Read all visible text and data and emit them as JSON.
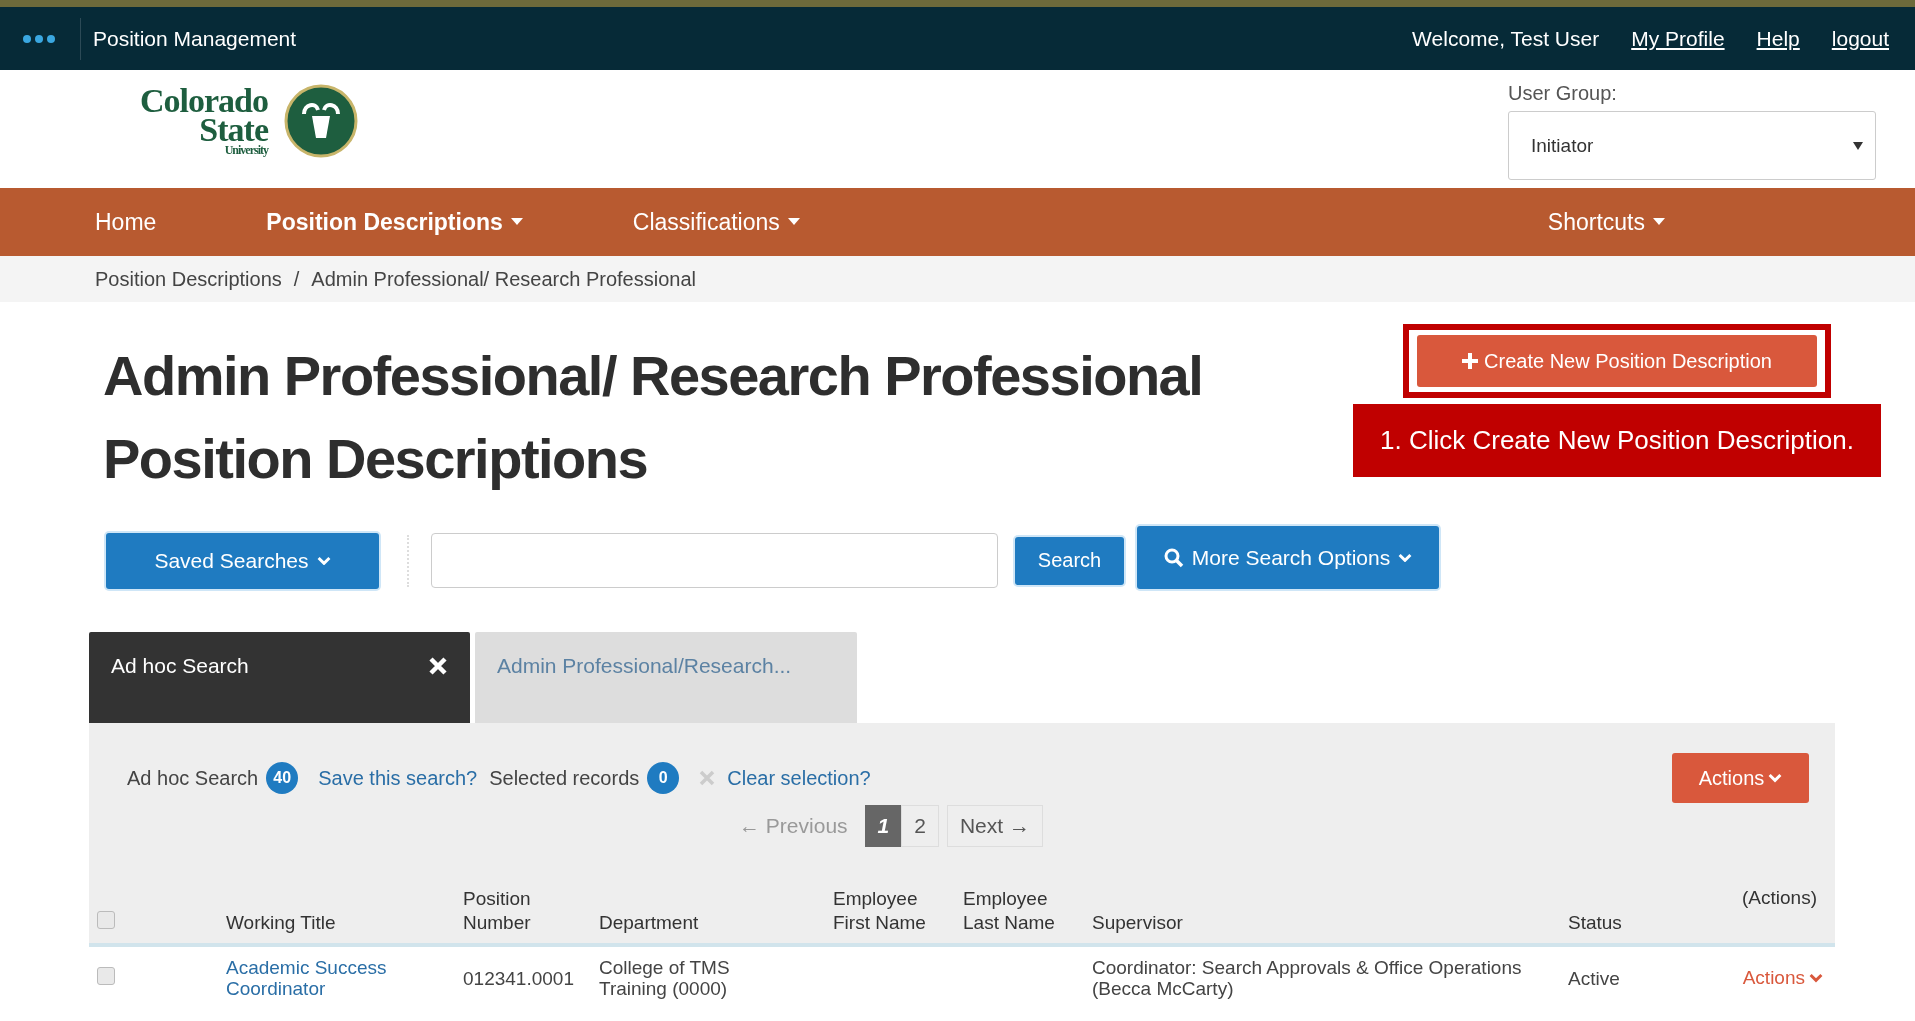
{
  "topbar": {
    "app_name": "Position Management",
    "welcome": "Welcome, Test User",
    "links": [
      "My Profile",
      "Help",
      "logout"
    ]
  },
  "logo": {
    "lines": [
      "Colorado",
      "State",
      "University"
    ]
  },
  "user_group": {
    "label": "User Group:",
    "value": "Initiator"
  },
  "nav": [
    {
      "label": "Home",
      "selected": false,
      "dropdown": false
    },
    {
      "label": "Position Descriptions",
      "selected": true,
      "dropdown": true
    },
    {
      "label": "Classifications",
      "selected": false,
      "dropdown": true
    },
    {
      "label": "Shortcuts",
      "selected": false,
      "dropdown": true
    }
  ],
  "breadcrumb": [
    "Position Descriptions",
    "Admin Professional/ Research Professional"
  ],
  "breadcrumb_separator": "/",
  "title_lines": [
    "Admin Professional/ Research Professional",
    "Position Descriptions"
  ],
  "create_button": {
    "label": "Create New Position Description",
    "highlighted": true
  },
  "callout": "1. Click Create New Position Description.",
  "search": {
    "saved_searches": "Saved Searches",
    "button": "Search",
    "more_options": "More Search Options"
  },
  "tabs": [
    {
      "label": "Ad hoc Search",
      "selected": true,
      "closable": true
    },
    {
      "label": "Admin Professional/Research...",
      "selected": false,
      "closable": false
    }
  ],
  "results": {
    "search_label": "Ad hoc Search",
    "count": "40",
    "save_link": "Save this search?",
    "selected_label": "Selected records",
    "selected_count": "0",
    "clear_link": "Clear selection?",
    "actions": "Actions"
  },
  "pagination": {
    "previous": "← Previous",
    "pages": [
      {
        "label": "1",
        "selected": true
      },
      {
        "label": "2",
        "selected": false
      }
    ],
    "next": "Next →"
  },
  "table": {
    "select_all_checked": false,
    "actions_heading": "(Actions)",
    "columns": [
      "Working Title",
      "Position Number",
      "Department",
      "Employee First Name",
      "Employee Last Name",
      "Supervisor",
      "Status"
    ],
    "rows": [
      {
        "checked": false,
        "cells": [
          "Academic Success Coordinator",
          "012341.0001",
          "College of TMS Training (0000)",
          null,
          null,
          "Coordinator: Search Approvals & Office Operations (Becca McCarty)",
          "Active"
        ],
        "action": "Actions"
      }
    ]
  }
}
